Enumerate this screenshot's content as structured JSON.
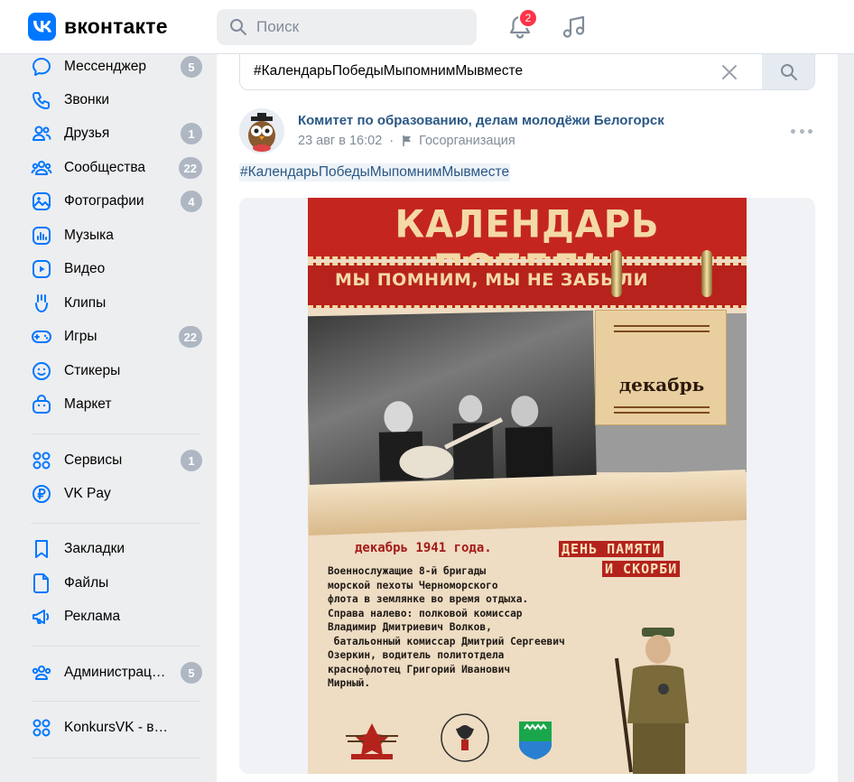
{
  "header": {
    "logo_text": "вконтакте",
    "search_placeholder": "Поиск",
    "notifications_count": "2"
  },
  "sidebar": {
    "items": [
      {
        "label": "Мессенджер",
        "icon": "message-icon",
        "count": "5"
      },
      {
        "label": "Звонки",
        "icon": "phone-icon",
        "count": ""
      },
      {
        "label": "Друзья",
        "icon": "friends-icon",
        "count": "1"
      },
      {
        "label": "Сообщества",
        "icon": "communities-icon",
        "count": "22"
      },
      {
        "label": "Фотографии",
        "icon": "photo-icon",
        "count": "4"
      },
      {
        "label": "Музыка",
        "icon": "music-icon",
        "count": ""
      },
      {
        "label": "Видео",
        "icon": "video-icon",
        "count": ""
      },
      {
        "label": "Клипы",
        "icon": "clips-icon",
        "count": ""
      },
      {
        "label": "Игры",
        "icon": "games-icon",
        "count": "22"
      },
      {
        "label": "Стикеры",
        "icon": "smile-icon",
        "count": ""
      },
      {
        "label": "Маркет",
        "icon": "market-icon",
        "count": ""
      },
      {
        "label": "Сервисы",
        "icon": "services-icon",
        "count": "1"
      },
      {
        "label": "VK Pay",
        "icon": "vkpay-icon",
        "count": ""
      },
      {
        "label": "Закладки",
        "icon": "bookmark-icon",
        "count": ""
      },
      {
        "label": "Файлы",
        "icon": "file-icon",
        "count": ""
      },
      {
        "label": "Реклама",
        "icon": "megaphone-icon",
        "count": ""
      },
      {
        "label": "Администрац…",
        "icon": "admin-icon",
        "count": "5"
      },
      {
        "label": "KonkursVK - выбор…",
        "icon": "app-icon",
        "count": ""
      }
    ]
  },
  "main": {
    "search_value": "#КалендарьПобедыМыпомнимМывместе",
    "post": {
      "author": "Комитет по образованию, делам молодёжи Белогорск",
      "date": "23 авг в 16:02",
      "category": "Госорганизация",
      "hashtag": "#КалендарьПобедыМыпомнимМывместе"
    },
    "poster": {
      "title": "КАЛЕНДАРЬ ПОБЕДЫ",
      "subtitle": "МЫ ПОМНИМ, МЫ НЕ ЗАБЫЛИ",
      "month": "декабрь",
      "date_line": "декабрь 1941 года.",
      "day_line1": "ДЕНЬ ПАМЯТИ",
      "day_line2": "И СКОРБИ",
      "body": "Военнослужащие 8-й бригады\nморской пехоты Черноморского\nфлота в землянке во время отдыха.\nСправа налево: полковой комиссар\nВладимир Дмитриевич Волков,\n батальонный комиссар Дмитрий Сергеевич\nОзеркин, водитель политотдела\nкраснофлотец Григорий Иванович\nМирный."
    }
  },
  "colors": {
    "accent": "#0077ff",
    "link": "#2a5885",
    "badge": "#ff3347",
    "counter": "#aeb7c2",
    "poster_red": "#c4261f"
  }
}
